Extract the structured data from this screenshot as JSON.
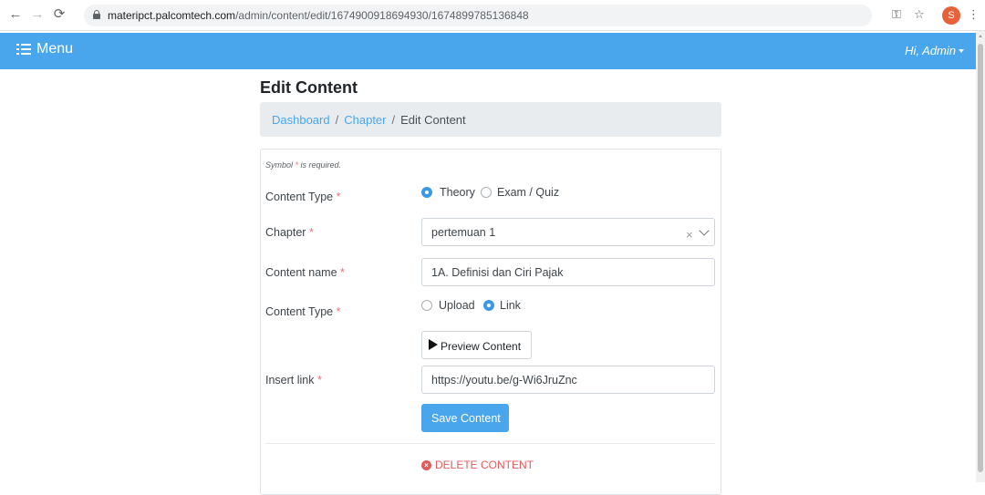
{
  "browser": {
    "url_host": "materipct.palcomtech.com",
    "url_path": "/admin/content/edit/1674900918694930/1674899785136848",
    "profile_initial": "S",
    "icons": [
      "back-arrow-icon",
      "forward-arrow-icon",
      "reload-icon",
      "lock-icon",
      "key-icon",
      "star-icon",
      "more-vert-icon"
    ]
  },
  "navbar": {
    "menu_label": "Menu",
    "user_greeting": "Hi, Admin",
    "color": "#4aa6ec"
  },
  "page": {
    "title": "Edit Content",
    "breadcrumb": [
      "Dashboard",
      "Chapter",
      "Edit Content"
    ]
  },
  "form": {
    "required_note_prefix": "Symbol ",
    "required_note_star": "*",
    "required_note_suffix": " is required.",
    "content_type_1": {
      "label": "Content Type",
      "options": [
        "Theory",
        "Exam / Quiz"
      ],
      "selected": "Theory"
    },
    "chapter": {
      "label": "Chapter",
      "value": "pertemuan 1",
      "clear_symbol": "×"
    },
    "content_name": {
      "label": "Content name",
      "value": "1A. Definisi dan Ciri Pajak"
    },
    "content_type_2": {
      "label": "Content Type",
      "options": [
        "Upload",
        "Link"
      ],
      "selected": "Link"
    },
    "preview_button": "Preview Content",
    "insert_link": {
      "label": "Insert link",
      "value": "https://youtu.be/g-Wi6JruZnc"
    },
    "save_button": "Save Content",
    "delete_button": "DELETE CONTENT",
    "required_star": "*"
  }
}
